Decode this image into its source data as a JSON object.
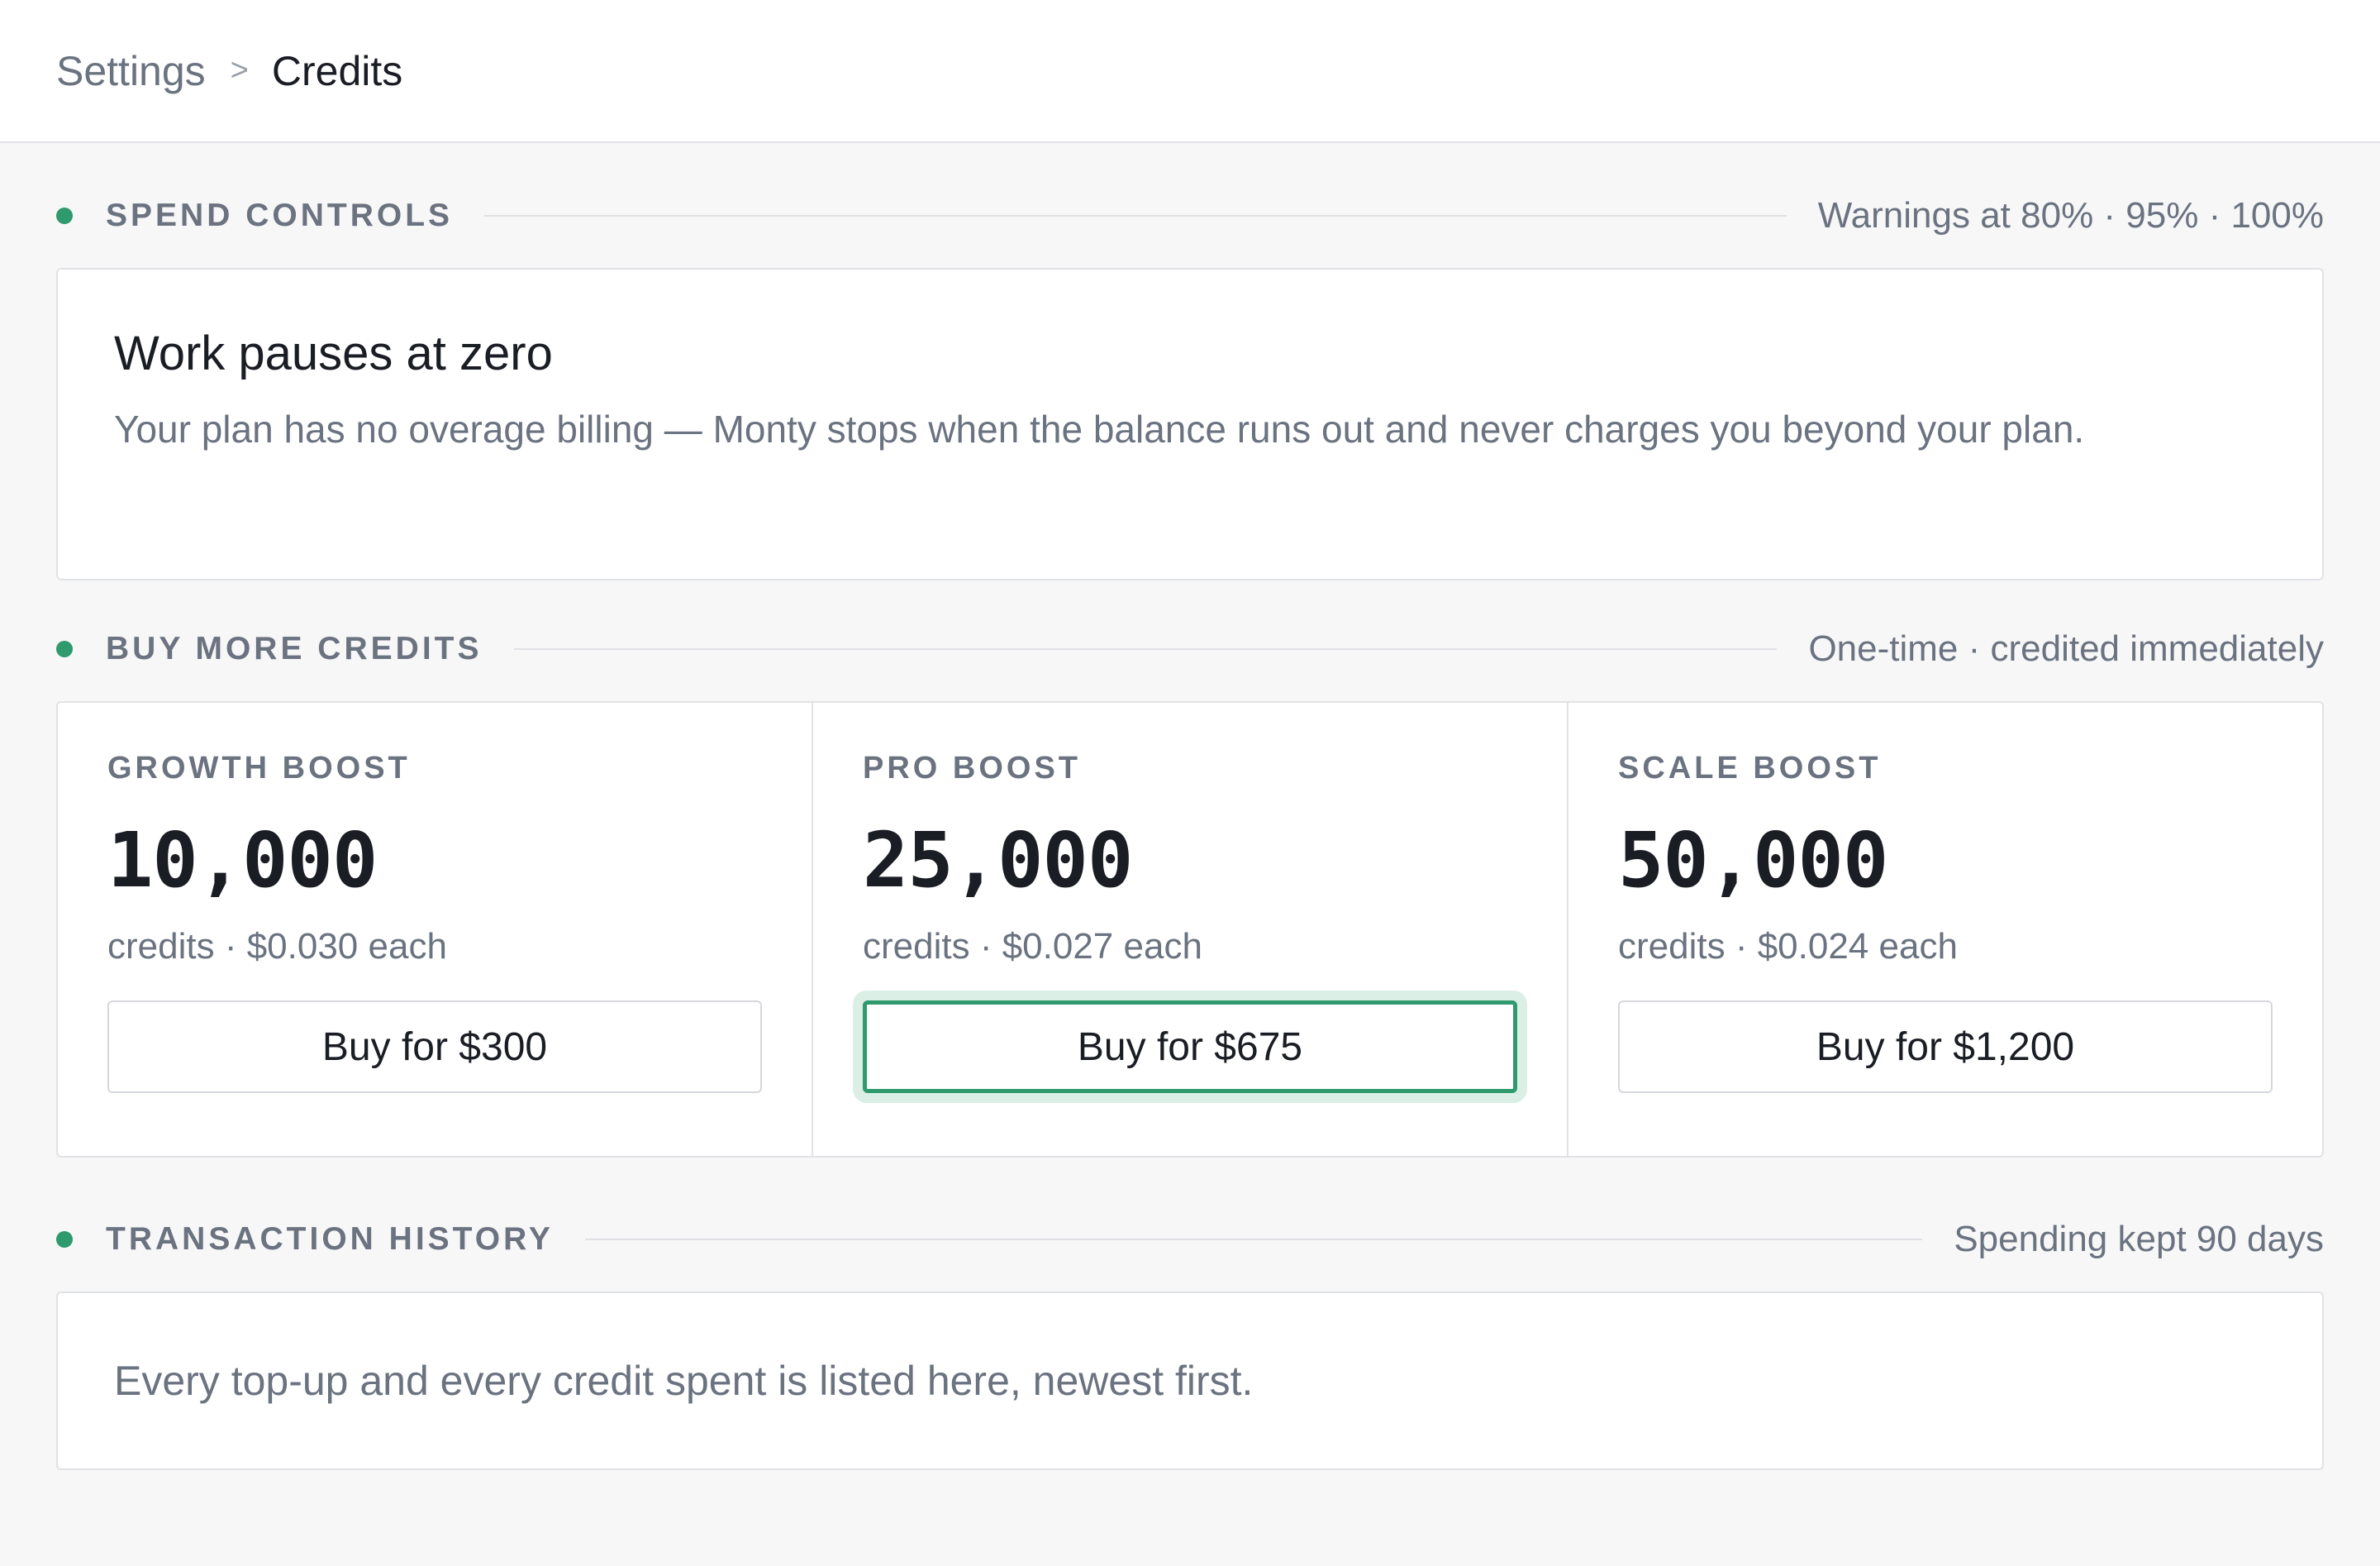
{
  "breadcrumb": {
    "root": "Settings",
    "separator": ">",
    "current": "Credits"
  },
  "spend_controls": {
    "title": "SPEND CONTROLS",
    "meta": "Warnings at 80% · 95% · 100%",
    "heading": "Work pauses at zero",
    "body": "Your plan has no overage billing — Monty stops when the balance runs out and never charges you beyond your plan."
  },
  "buy_credits": {
    "title": "BUY MORE CREDITS",
    "meta": "One-time · credited immediately",
    "boosts": [
      {
        "name": "GROWTH BOOST",
        "amount": "10,000",
        "price_text": "credits · $0.030 each",
        "button_label": "Buy for $300"
      },
      {
        "name": "PRO BOOST",
        "amount": "25,000",
        "price_text": "credits · $0.027 each",
        "button_label": "Buy for $675"
      },
      {
        "name": "SCALE BOOST",
        "amount": "50,000",
        "price_text": "credits · $0.024 each",
        "button_label": "Buy for $1,200"
      }
    ]
  },
  "transaction_history": {
    "title": "TRANSACTION HISTORY",
    "meta": "Spending kept 90 days",
    "body": "Every top-up and every credit spent is listed here, newest first."
  },
  "colors": {
    "accent": "#2e9a6e",
    "focus_ring": "#dcefe6",
    "muted_text": "#6b7280",
    "background": "#f7f7f7"
  }
}
